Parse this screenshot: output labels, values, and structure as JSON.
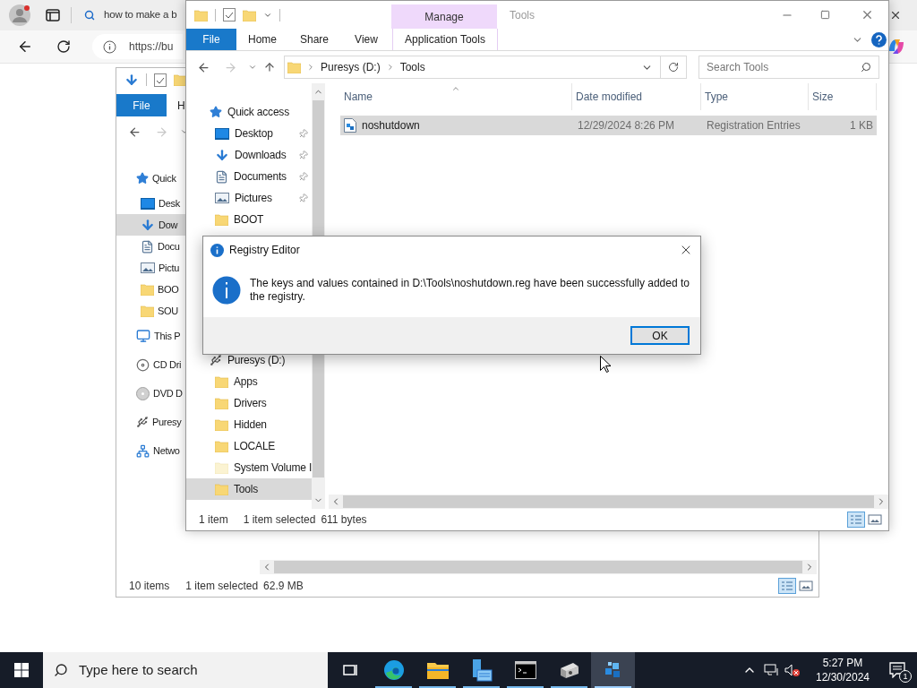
{
  "browser": {
    "tab_title": "how to make a b",
    "address": "https://bu"
  },
  "back_explorer": {
    "ribbon_tabs": [
      {
        "label": "File",
        "kind": "file"
      },
      {
        "label": "H",
        "kind": "tab"
      }
    ],
    "nav_tree": [
      {
        "label": "Quick",
        "kind": "star",
        "selected": false,
        "children": [
          {
            "label": "Desk",
            "kind": "desktop",
            "selected": false
          },
          {
            "label": "Dow",
            "kind": "download",
            "selected": true
          },
          {
            "label": "Docu",
            "kind": "document",
            "selected": false
          },
          {
            "label": "Pictu",
            "kind": "pictures",
            "selected": false
          },
          {
            "label": "BOO",
            "kind": "folder",
            "selected": false
          },
          {
            "label": "SOU",
            "kind": "folder",
            "selected": false
          }
        ]
      },
      {
        "label": "This P",
        "kind": "pc",
        "selected": false
      },
      {
        "label": "CD Dri",
        "kind": "cd",
        "selected": false
      },
      {
        "label": "DVD D",
        "kind": "dvd",
        "selected": false
      },
      {
        "label": "Puresy",
        "kind": "usb",
        "selected": false
      },
      {
        "label": "Netwo",
        "kind": "network",
        "selected": false
      }
    ],
    "status": {
      "item_count": "10 items",
      "selection": "1 item selected",
      "size": "62.9 MB"
    }
  },
  "front_explorer": {
    "title": "Tools",
    "context_tab": "Manage",
    "ribbon_tabs": [
      {
        "label": "File",
        "kind": "file"
      },
      {
        "label": "Home",
        "kind": "tab"
      },
      {
        "label": "Share",
        "kind": "tab"
      },
      {
        "label": "View",
        "kind": "tab"
      },
      {
        "label": "Application Tools",
        "kind": "context"
      }
    ],
    "address_path": [
      "Puresys (D:)",
      "Tools"
    ],
    "search": {
      "placeholder": "Search Tools"
    },
    "nav_tree": [
      {
        "label": "Quick access",
        "kind": "star",
        "selected": false,
        "children": [
          {
            "label": "Desktop",
            "kind": "desktop",
            "selected": false,
            "pinned": true
          },
          {
            "label": "Downloads",
            "kind": "download",
            "selected": false,
            "pinned": true
          },
          {
            "label": "Documents",
            "kind": "document",
            "selected": false,
            "pinned": true
          },
          {
            "label": "Pictures",
            "kind": "pictures",
            "selected": false,
            "pinned": true
          },
          {
            "label": "BOOT",
            "kind": "folder",
            "selected": false,
            "pinned": false
          }
        ]
      },
      {
        "label": "Puresys (D:)",
        "kind": "usb",
        "selected": false,
        "children": [
          {
            "label": "Apps",
            "kind": "folder",
            "selected": false
          },
          {
            "label": "Drivers",
            "kind": "folder",
            "selected": false
          },
          {
            "label": "Hidden",
            "kind": "folder",
            "selected": false
          },
          {
            "label": "LOCALE",
            "kind": "folder",
            "selected": false
          },
          {
            "label": "System Volume I",
            "kind": "folder-hidden",
            "selected": false
          },
          {
            "label": "Tools",
            "kind": "folder",
            "selected": true
          }
        ]
      }
    ],
    "table": {
      "columns": [
        {
          "label": "Name",
          "sorted": true
        },
        {
          "label": "Date modified",
          "sorted": false
        },
        {
          "label": "Type",
          "sorted": false
        },
        {
          "label": "Size",
          "sorted": false
        }
      ],
      "rows": [
        {
          "name": "noshutdown",
          "date_modified": "12/29/2024 8:26 PM",
          "type": "Registration Entries",
          "size": "1 KB",
          "selected": true
        }
      ]
    },
    "status": {
      "item_count": "1 item",
      "selection": "1 item selected",
      "size": "611 bytes"
    }
  },
  "dialog": {
    "title": "Registry Editor",
    "message": "The keys and values contained in D:\\Tools\\noshutdown.reg have been successfully added to the registry.",
    "button": "OK"
  },
  "taskbar": {
    "search_placeholder": "Type here to search",
    "apps": [
      {
        "kind": "task-view",
        "running": false,
        "selected": false
      },
      {
        "kind": "edge",
        "running": true,
        "selected": false
      },
      {
        "kind": "explorer",
        "running": true,
        "selected": false
      },
      {
        "kind": "server",
        "running": true,
        "selected": false
      },
      {
        "kind": "terminal",
        "running": true,
        "selected": false
      },
      {
        "kind": "tools",
        "running": true,
        "selected": false
      },
      {
        "kind": "registry",
        "running": true,
        "selected": true
      }
    ],
    "clock": {
      "time": "5:27 PM",
      "date": "12/30/2024"
    },
    "notification_count": "1"
  }
}
